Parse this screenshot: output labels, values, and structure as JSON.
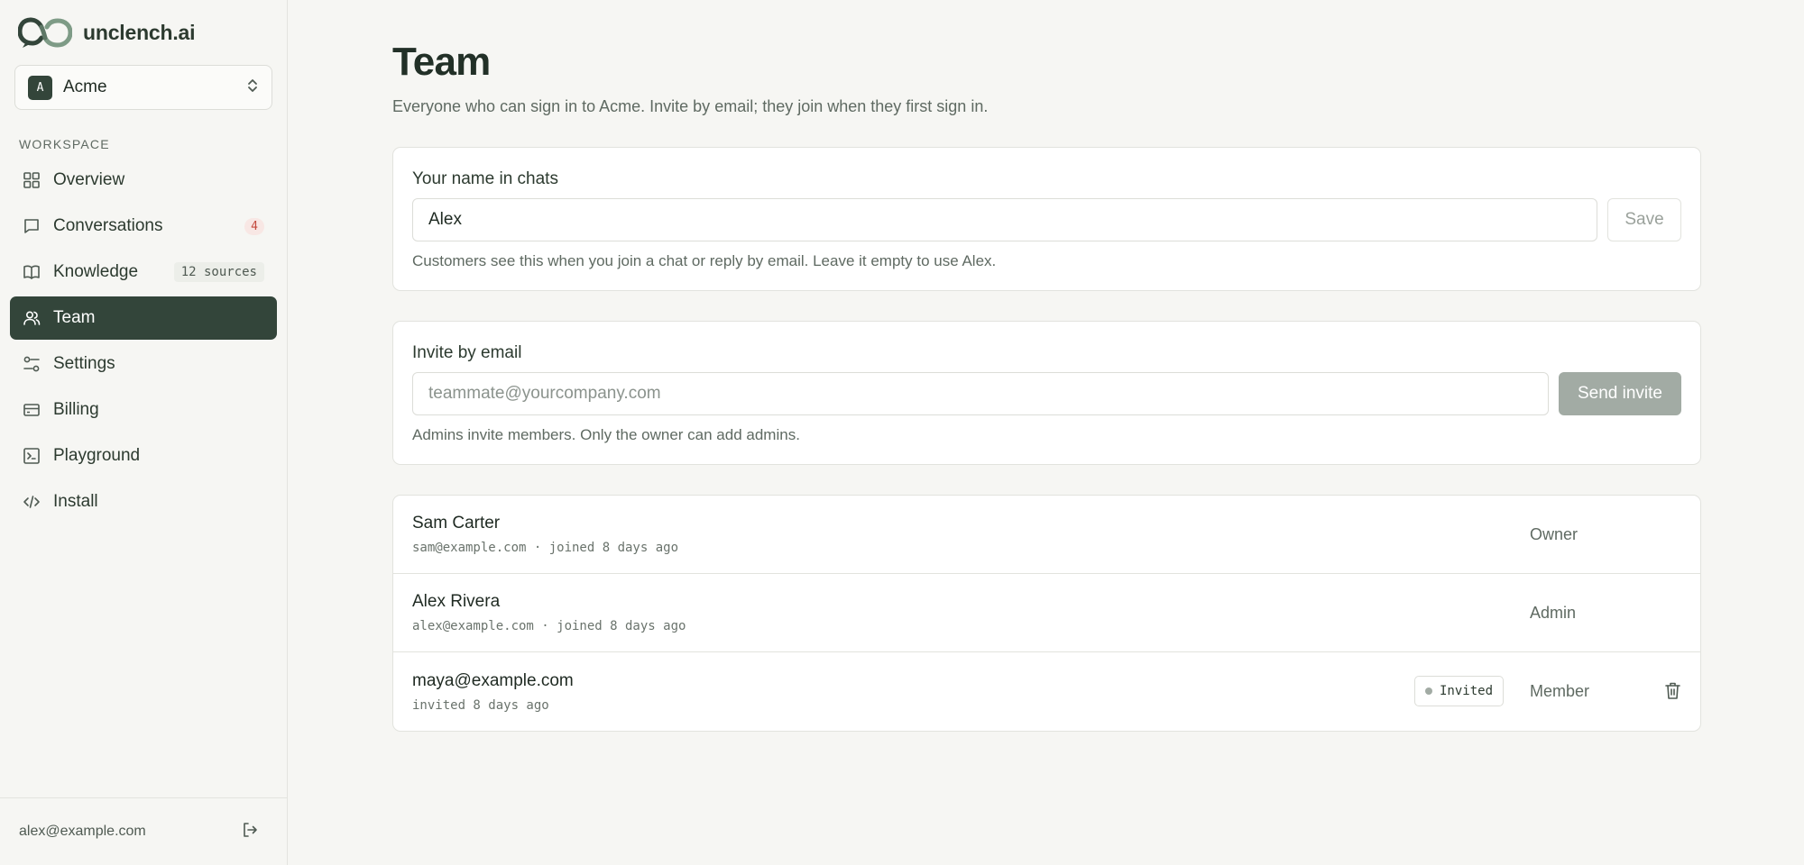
{
  "brand": {
    "name": "unclench.ai"
  },
  "workspace": {
    "initial": "A",
    "name": "Acme"
  },
  "sidebar": {
    "section_label": "WORKSPACE",
    "items": [
      {
        "label": "Overview",
        "icon": "grid-icon"
      },
      {
        "label": "Conversations",
        "icon": "chat-icon",
        "badge": "4"
      },
      {
        "label": "Knowledge",
        "icon": "book-icon",
        "badge": "12 sources"
      },
      {
        "label": "Team",
        "icon": "users-icon",
        "active": true
      },
      {
        "label": "Settings",
        "icon": "sliders-icon"
      },
      {
        "label": "Billing",
        "icon": "card-icon"
      },
      {
        "label": "Playground",
        "icon": "terminal-icon"
      },
      {
        "label": "Install",
        "icon": "code-icon"
      }
    ],
    "footer_email": "alex@example.com"
  },
  "page": {
    "title": "Team",
    "subtitle": "Everyone who can sign in to Acme. Invite by email; they join when they first sign in."
  },
  "name_card": {
    "label": "Your name in chats",
    "value": "Alex",
    "save_label": "Save",
    "help": "Customers see this when you join a chat or reply by email. Leave it empty to use Alex."
  },
  "invite_card": {
    "label": "Invite by email",
    "placeholder": "teammate@yourcompany.com",
    "send_label": "Send invite",
    "help": "Admins invite members. Only the owner can add admins."
  },
  "members": [
    {
      "name": "Sam Carter",
      "meta": "sam@example.com · joined 8 days ago",
      "role": "Owner"
    },
    {
      "name": "Alex Rivera",
      "meta": "alex@example.com · joined 8 days ago",
      "role": "Admin"
    },
    {
      "name": "maya@example.com",
      "meta": "invited 8 days ago",
      "status": "Invited",
      "role": "Member"
    }
  ],
  "colors": {
    "accent": "#33453a",
    "background": "#f6f6f3",
    "badge_red": "#c44a3e"
  }
}
